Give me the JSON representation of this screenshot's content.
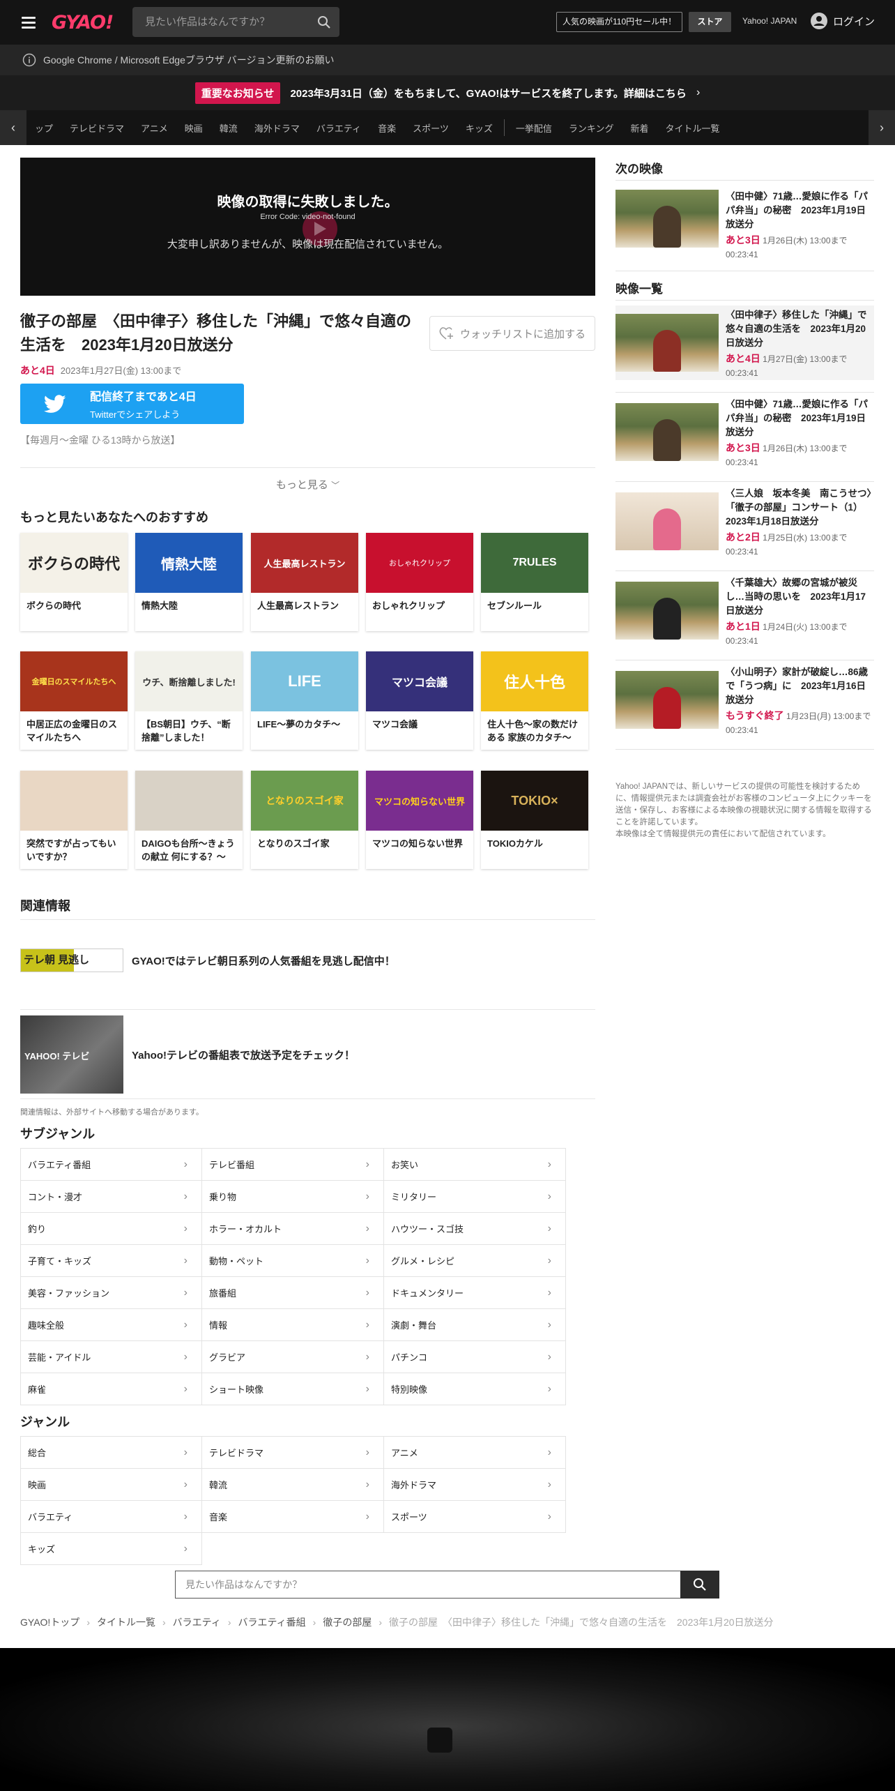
{
  "header": {
    "logo": "GYAO!",
    "search_placeholder": "見たい作品はなんですか？",
    "promo": "人気の映画が110円セール中！",
    "store": "ストア",
    "yahoo": "Yahoo! JAPAN",
    "login": "ログイン"
  },
  "notice": {
    "browser": "Google Chrome / Microsoft Edgeブラウザ バージョン更新のお願い",
    "tag": "重要なお知らせ",
    "message": "2023年3月31日（金）をもちまして、GYAO!はサービスを終了します。詳細はこちら"
  },
  "nav": {
    "items": [
      "ップ",
      "テレビドラマ",
      "アニメ",
      "映画",
      "韓流",
      "海外ドラマ",
      "バラエティ",
      "音楽",
      "スポーツ",
      "キッズ"
    ],
    "items2": [
      "一挙配信",
      "ランキング",
      "新着",
      "タイトル一覧"
    ]
  },
  "player": {
    "title": "映像の取得に失敗しました。",
    "code": "Error Code: video-not-found",
    "message": "大変申し訳ありませんが、映像は現在配信されていません。"
  },
  "video": {
    "title": "徹子の部屋　〈田中律子〉移住した「沖縄」で悠々自適の生活を　2023年1月20日放送分",
    "watchlist": "ウォッチリストに追加する",
    "remain": "あと4日",
    "until": "2023年1月27日(金) 13:00まで",
    "twitter_line1": "配信終了まであと4日",
    "twitter_line2": "Twitterでシェアしよう",
    "schedule": "【毎週月～金曜 ひる13時から放送】",
    "more": "もっと見る"
  },
  "recommend": {
    "heading": "もっと見たいあなたへのおすすめ",
    "items": [
      {
        "title": "ボクらの時代",
        "thumb_text": "ボクらの時代"
      },
      {
        "title": "情熱大陸",
        "thumb_text": "情熱大陸"
      },
      {
        "title": "人生最高レストラン",
        "thumb_text": "人生最高レストラン"
      },
      {
        "title": "おしゃれクリップ",
        "thumb_text": "おしゃれクリップ"
      },
      {
        "title": "セブンルール",
        "thumb_text": "7RULES"
      },
      {
        "title": "中居正広の金曜日のスマイルたちへ",
        "thumb_text": "金曜日のスマイルたちへ"
      },
      {
        "title": "【BS朝日】ウチ、“断捨離”しました！",
        "thumb_text": "ウチ、断捨離しました!"
      },
      {
        "title": "LIFE～夢のカタチ～",
        "thumb_text": "LIFE"
      },
      {
        "title": "マツコ会議",
        "thumb_text": "マツコ会議"
      },
      {
        "title": "住人十色～家の数だけある 家族のカタチ～",
        "thumb_text": "住人十色"
      },
      {
        "title": "突然ですが占ってもいいですか？",
        "thumb_text": ""
      },
      {
        "title": "DAIGOも台所～きょうの献立 何にする？～",
        "thumb_text": ""
      },
      {
        "title": "となりのスゴイ家",
        "thumb_text": "となりのスゴイ家"
      },
      {
        "title": "マツコの知らない世界",
        "thumb_text": "マツコの知らない世界"
      },
      {
        "title": "TOKIOカケル",
        "thumb_text": "TOKIO×"
      }
    ]
  },
  "related": {
    "heading": "関連情報",
    "item1_logo": "テレ朝 見逃し",
    "item1": "GYAO!ではテレビ朝日系列の人気番組を見逃し配信中！",
    "item2": "Yahoo!テレビの番組表で放送予定をチェック！",
    "item2_logo": "YAHOO! テレビ",
    "note": "関連情報は、外部サイトへ移動する場合があります。"
  },
  "subgenre": {
    "heading": "サブジャンル",
    "items": [
      "バラエティ番組",
      "テレビ番組",
      "お笑い",
      "コント・漫才",
      "乗り物",
      "ミリタリー",
      "釣り",
      "ホラー・オカルト",
      "ハウツー・スゴ技",
      "子育て・キッズ",
      "動物・ペット",
      "グルメ・レシピ",
      "美容・ファッション",
      "旅番組",
      "ドキュメンタリー",
      "趣味全般",
      "情報",
      "演劇・舞台",
      "芸能・アイドル",
      "グラビア",
      "パチンコ",
      "麻雀",
      "ショート映像",
      "特別映像"
    ]
  },
  "genre": {
    "heading": "ジャンル",
    "items": [
      "総合",
      "テレビドラマ",
      "アニメ",
      "映画",
      "韓流",
      "海外ドラマ",
      "バラエティ",
      "音楽",
      "スポーツ",
      "キッズ"
    ]
  },
  "bottom_search_placeholder": "見たい作品はなんですか？",
  "breadcrumb": [
    "GYAO!トップ",
    "タイトル一覧",
    "バラエティ",
    "バラエティ番組",
    "徹子の部屋",
    "徹子の部屋　〈田中律子〉移住した「沖縄」で悠々自適の生活を　2023年1月20日放送分"
  ],
  "sidebar": {
    "next_heading": "次の映像",
    "next": {
      "title": "〈田中健〉71歳…愛娘に作る「パパ弁当」の秘密　2023年1月19日放送分",
      "remain": "あと3日",
      "until": "1月26日(木) 13:00まで",
      "duration": "00:23:41"
    },
    "list_heading": "映像一覧",
    "list": [
      {
        "title": "〈田中律子〉移住した「沖縄」で悠々自適の生活を　2023年1月20日放送分",
        "remain": "あと4日",
        "until": "1月27日(金) 13:00まで",
        "duration": "00:23:41"
      },
      {
        "title": "〈田中健〉71歳…愛娘に作る「パパ弁当」の秘密　2023年1月19日放送分",
        "remain": "あと3日",
        "until": "1月26日(木) 13:00まで",
        "duration": "00:23:41"
      },
      {
        "title": "〈三人娘　坂本冬美　南こうせつ〉「徹子の部屋」コンサート（1）　2023年1月18日放送分",
        "remain": "あと2日",
        "until": "1月25日(水) 13:00まで",
        "duration": "00:23:41"
      },
      {
        "title": "〈千葉雄大〉故郷の宮城が被災し…当時の思いを　2023年1月17日放送分",
        "remain": "あと1日",
        "until": "1月24日(火) 13:00まで",
        "duration": "00:23:41"
      },
      {
        "title": "〈小山明子〉家計が破綻し…86歳で「うつ病」に　2023年1月16日放送分",
        "remain": "もうすぐ終了",
        "until": "1月23日(月) 13:00まで",
        "duration": "00:23:41"
      }
    ],
    "disclaimer": "Yahoo! JAPANでは、新しいサービスの提供の可能性を検討するために、情報提供元または調査会社がお客様のコンピュータ上にクッキーを送信・保存し、お客様による本映像の視聴状況に関する情報を取得することを許諾しています。\n本映像は全て情報提供元の責任において配信されています。"
  }
}
